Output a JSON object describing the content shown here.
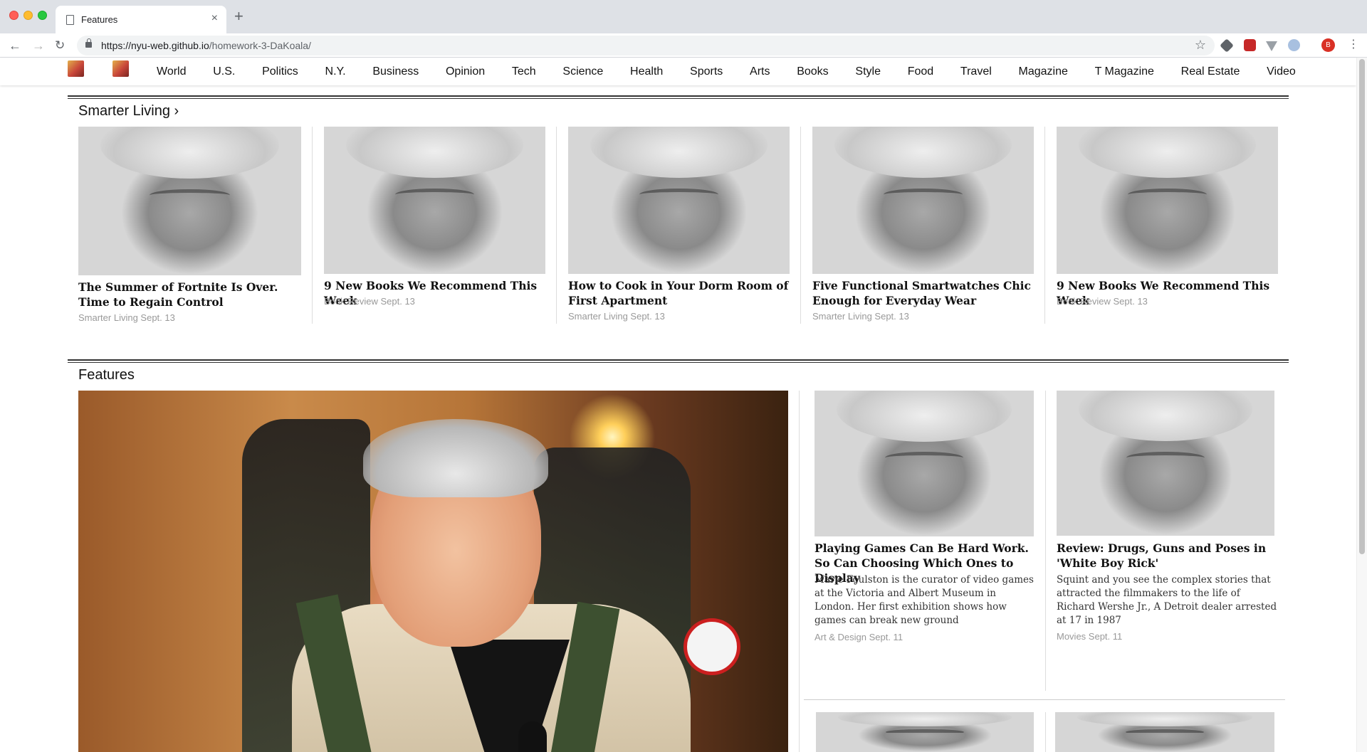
{
  "browser": {
    "tab_title": "Features",
    "url_host": "https://nyu-web.github.io",
    "url_path": "/homework-3-DaKoala/",
    "profile_initial": "B",
    "new_tab_symbol": "+",
    "close_symbol": "×"
  },
  "nav": {
    "items": [
      "World",
      "U.S.",
      "Politics",
      "N.Y.",
      "Business",
      "Opinion",
      "Tech",
      "Science",
      "Health",
      "Sports",
      "Arts",
      "Books",
      "Style",
      "Food",
      "Travel",
      "Magazine",
      "T Magazine",
      "Real Estate",
      "Video"
    ]
  },
  "smarter_living": {
    "title": "Smarter Living ›",
    "cards": [
      {
        "title": "The Summer of Fortnite Is Over. Time to Regain Control",
        "meta": "Smarter Living Sept. 13"
      },
      {
        "title": "9 New Books We Recommend This Week",
        "meta": "Book Review Sept. 13"
      },
      {
        "title": "How to Cook in Your Dorm Room of First Apartment",
        "meta": "Smarter Living Sept. 13"
      },
      {
        "title": "Five Functional Smartwatches Chic Enough for Everyday Wear",
        "meta": "Smarter Living Sept. 13"
      },
      {
        "title": "9 New Books We Recommend This Week",
        "meta": "Book Review Sept. 13"
      }
    ]
  },
  "features": {
    "title": "Features",
    "cards": [
      {
        "title": "Playing Games Can Be Hard Work. So Can Choosing Which Ones to Display",
        "summary": "Marie Foulston is the curator of video games at the Victoria and Albert Museum in London. Her first exhibition shows how games can break new ground",
        "meta": "Art & Design Sept. 11"
      },
      {
        "title": "Review: Drugs, Guns and Poses in 'White Boy Rick'",
        "summary": "Squint and you see the complex stories that attracted the filmmakers to the life of Richard Wershe Jr., A Detroit dealer arrested at 17 in 1987",
        "meta": "Movies Sept. 11"
      }
    ]
  },
  "icons": [
    "back-arrow-icon",
    "forward-arrow-icon",
    "reload-icon",
    "lock-icon",
    "star-icon",
    "page-icon",
    "close-icon",
    "new-tab-icon",
    "menu-icon"
  ],
  "colors": {
    "tabstrip": "#dee1e6",
    "omnibox": "#f1f3f4",
    "meta_text": "#999999",
    "rule": "#333333",
    "profile": "#d93025"
  }
}
